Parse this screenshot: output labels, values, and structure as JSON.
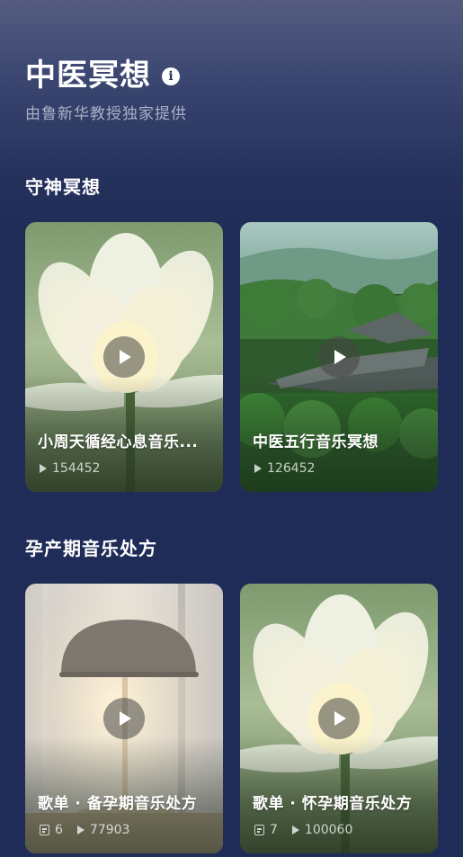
{
  "header": {
    "title": "中医冥想",
    "info_icon": "info-icon",
    "subtitle": "由鲁新华教授独家提供"
  },
  "sections": [
    {
      "title": "守神冥想",
      "cards": [
        {
          "title": "小周天循经心息音乐...",
          "plays": "154452",
          "image": "white-lotus"
        },
        {
          "title": "中医五行音乐冥想",
          "plays": "126452",
          "image": "pavilion-forest"
        }
      ]
    },
    {
      "title": "孕产期音乐处方",
      "cards": [
        {
          "title": "歌单 · 备孕期音乐处方",
          "tracks": "6",
          "plays": "77903",
          "image": "table-lamp"
        },
        {
          "title": "歌单 · 怀孕期音乐处方",
          "tracks": "7",
          "plays": "100060",
          "image": "white-lotus"
        }
      ]
    }
  ],
  "icons": {
    "play": "play-icon",
    "track_count": "list-icon"
  }
}
